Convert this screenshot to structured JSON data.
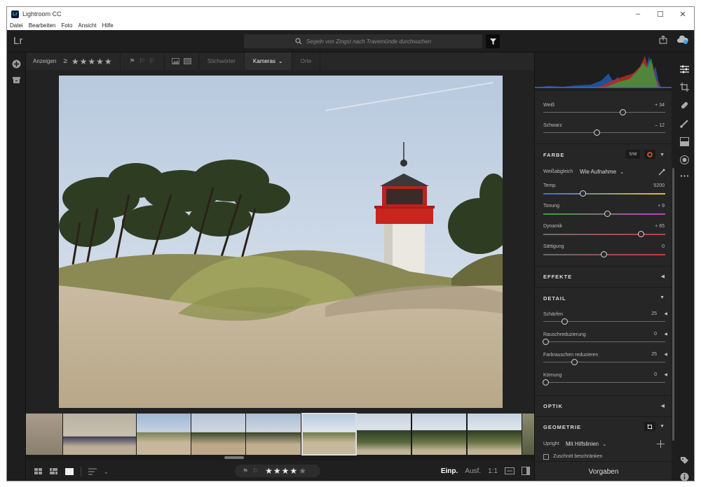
{
  "window": {
    "title": "Lightroom CC",
    "app_icon": "Lr",
    "minimize": "–",
    "maximize": "☐",
    "close": "✕"
  },
  "menu": [
    "Datei",
    "Bearbeiten",
    "Foto",
    "Ansicht",
    "Hilfe"
  ],
  "topbar": {
    "logo": "Lr",
    "search_placeholder": "Segeln von Zingst nach Travemünde durchsuchen"
  },
  "filterbar": {
    "anzeigen": "Anzeigen",
    "operator": "≥",
    "stars": "★★★★★",
    "stichwoerter": "Stichwörter",
    "kameras": "Kameras",
    "orte": "Orte"
  },
  "bottombar": {
    "rating_stars": "★★★★",
    "rating_empty": "★",
    "einp": "Einp.",
    "ausf": "Ausf.",
    "one_one": "1:1"
  },
  "panel": {
    "weiss": {
      "label": "Weiß",
      "value": "+ 34"
    },
    "schwarz": {
      "label": "Schwarz",
      "value": "– 12"
    },
    "farbe_title": "FARBE",
    "sw_button": "S/W",
    "weissabgleich_label": "Weißabgleich",
    "weissabgleich_value": "Wie Aufnahme",
    "temp": {
      "label": "Temp.",
      "value": "5200"
    },
    "tonung": {
      "label": "Tonung",
      "value": "+ 9"
    },
    "dynamik": {
      "label": "Dynamik",
      "value": "+ 65"
    },
    "saettigung": {
      "label": "Sättigung",
      "value": "0"
    },
    "effekte_title": "EFFEKTE",
    "detail_title": "DETAIL",
    "schaerfen": {
      "label": "Schärfen",
      "value": "25"
    },
    "rauschreduzierung": {
      "label": "Rauschreduzierung",
      "value": "0"
    },
    "farbrauschen": {
      "label": "Farbrauschen reduzieren",
      "value": "25"
    },
    "koernung": {
      "label": "Körnung",
      "value": "0"
    },
    "optik_title": "OPTIK",
    "geometrie_title": "GEOMETRIE",
    "upright_label": "Upright",
    "upright_value": "Mit Hilfslinien",
    "zuschnitt_label": "Zuschnitt beschränken",
    "vorgaben": "Vorgaben"
  },
  "colors": {
    "accent": "#31a8ff",
    "lighthouse_red": "#c8251e",
    "panel_bg": "#262626"
  }
}
